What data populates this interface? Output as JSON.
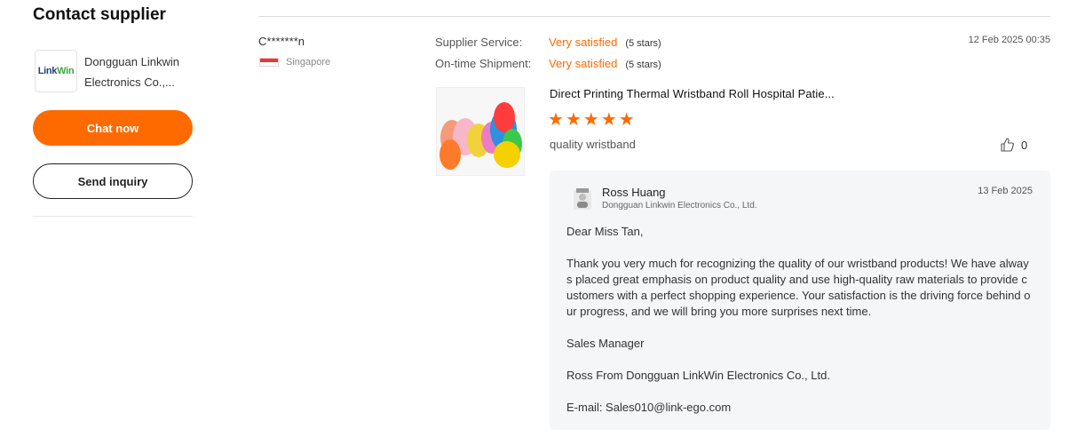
{
  "left": {
    "title": "Contact supplier",
    "logo": {
      "part1": "Link",
      "part2": "Win"
    },
    "supplier_name": "Dongguan Linkwin Electronics Co.,...",
    "chat_button": "Chat now",
    "inquiry_button": "Send inquiry"
  },
  "review": {
    "reviewer": "C*******n",
    "country": "Singapore",
    "date": "12 Feb 2025 00:35",
    "ratings": [
      {
        "label": "Supplier Service:",
        "value": "Very satisfied",
        "stars_text": "(5 stars)"
      },
      {
        "label": "On-time Shipment:",
        "value": "Very satisfied",
        "stars_text": "(5 stars)"
      }
    ],
    "product_title": "Direct Printing Thermal Wristband Roll Hospital Patie...",
    "product_rating": 5,
    "text": "quality wristband",
    "likes": "0"
  },
  "reply": {
    "name": "Ross Huang",
    "company": "Dongguan Linkwin Electronics Co., Ltd.",
    "date": "13 Feb 2025",
    "paragraphs": [
      "Dear Miss Tan,",
      "Thank you very much for recognizing the quality of our wristband products! We have always placed great emphasis on product quality and use high-quality raw materials to provide customers with a perfect shopping experience. Your satisfaction is the driving force behind our progress, and we will bring you more surprises next time.",
      "Sales Manager",
      "Ross From Dongguan LinkWin Electronics Co., Ltd.",
      "E-mail: Sales010@link-ego.com"
    ]
  },
  "icons": {
    "flag": "singapore-flag-icon",
    "star": "star-icon",
    "like": "thumbs-up-icon",
    "avatar": "avatar"
  },
  "colors": {
    "accent": "#ff6a00",
    "reply_bg": "#f5f6f8"
  }
}
